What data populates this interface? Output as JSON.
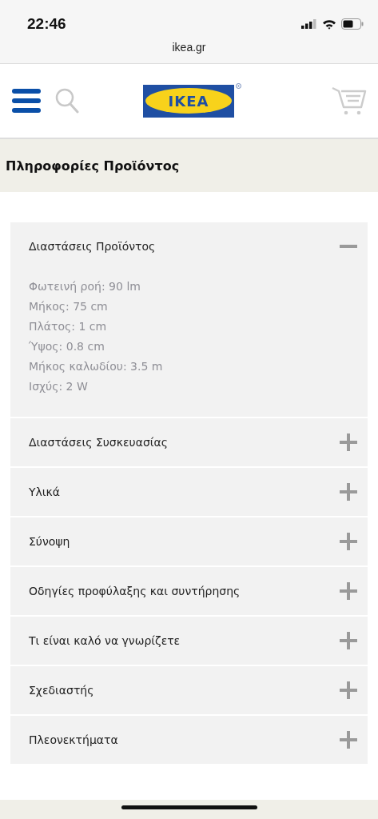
{
  "status_bar": {
    "time": "22:46"
  },
  "address_bar": {
    "url": "ikea.gr"
  },
  "header": {
    "logo": "IKEA"
  },
  "section_title": "Πληροφορίες Προϊόντος",
  "sections": [
    {
      "title": "Διαστάσεις Προϊόντος",
      "expanded": true,
      "details": [
        "Φωτεινή ροή: 90 lm",
        "Μήκος: 75 cm",
        "Πλάτος: 1 cm",
        "Ύψος: 0.8 cm",
        "Μήκος καλωδίου: 3.5 m",
        "Ισχύς: 2 W"
      ]
    },
    {
      "title": "Διαστάσεις Συσκευασίας",
      "expanded": false
    },
    {
      "title": "Υλικά",
      "expanded": false
    },
    {
      "title": "Σύνοψη",
      "expanded": false
    },
    {
      "title": "Οδηγίες προφύλαξης και συντήρησης",
      "expanded": false
    },
    {
      "title": "Τι είναι καλό να γνωρίζετε",
      "expanded": false
    },
    {
      "title": "Σχεδιαστής",
      "expanded": false
    },
    {
      "title": "Πλεονεκτήματα",
      "expanded": false
    }
  ]
}
